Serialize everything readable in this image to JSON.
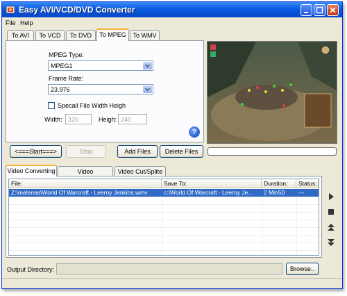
{
  "window": {
    "title": "Easy AVI/VCD/DVD Converter"
  },
  "menu": [
    "File",
    "Help"
  ],
  "format_tabs": [
    "To AVI",
    "To VCD",
    "To DVD",
    "To MPEG",
    "To WMV"
  ],
  "active_format_tab": "To MPEG",
  "settings": {
    "mpeg_type_label": "MPEG Type:",
    "mpeg_type_value": "MPEG1",
    "frame_rate_label": "Frame Rate:",
    "frame_rate_value": "23.976",
    "special_size_label": "Specail File Width  Heigh",
    "width_label": "Width:",
    "width_value": "320",
    "height_label": "Heigh:",
    "height_value": "240"
  },
  "buttons": {
    "start": "<===Start===>",
    "stop": "Stop",
    "add_files": "Add Files",
    "delete_files": "Delete Files",
    "browse": "Browse.."
  },
  "bottom_tabs": [
    "Video Converting",
    "Video Join/Combine",
    "Video Cut/Splite"
  ],
  "active_bottom_tab": "Video Converting",
  "file_list": {
    "columns": [
      "File:",
      "Save To:",
      "Duration:",
      "Status:"
    ],
    "rows": [
      {
        "file": "Z:\\melenas\\World Of Warcraft - Leeroy Jenkins.wmv",
        "save_to": "c:\\World Of Warcraft - Leeroy Je...",
        "duration": "2  Min50",
        "status": "---"
      }
    ]
  },
  "output": {
    "label": "Output Directory:"
  },
  "colors": {
    "title_bar": "#0a5ae0",
    "selection": "#316ac5",
    "tab_highlight": "#f7b03a"
  }
}
